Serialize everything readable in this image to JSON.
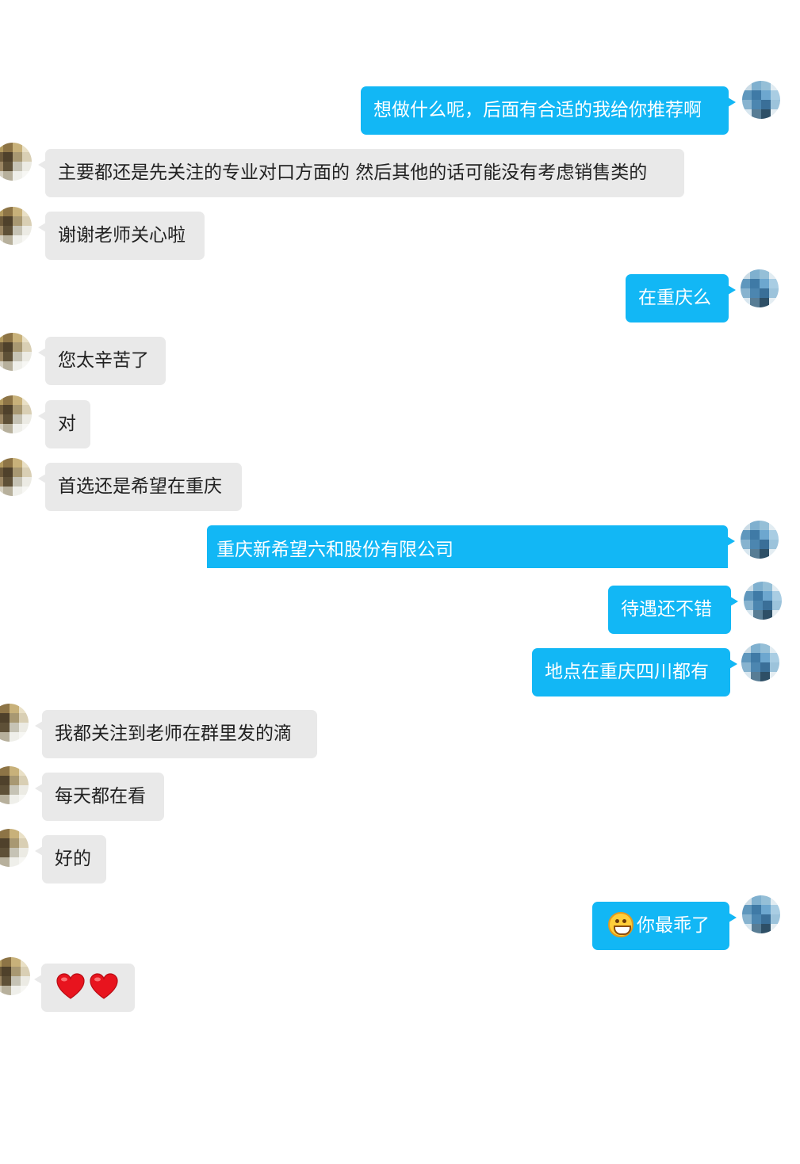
{
  "colors": {
    "incoming_bubble": "#e9e9e9",
    "outgoing_bubble": "#12b7f5",
    "incoming_text": "#222222",
    "outgoing_text": "#ffffff"
  },
  "messages": [
    {
      "side": "out",
      "text": "想做什么呢，后面有合适的我给你推荐啊"
    },
    {
      "side": "in",
      "text": "主要都还是先关注的专业对口方面的 然后其他的话可能没有考虑销售类的"
    },
    {
      "side": "in",
      "text": "谢谢老师关心啦"
    },
    {
      "side": "out",
      "text": "在重庆么"
    },
    {
      "side": "in",
      "text": "您太辛苦了"
    },
    {
      "side": "in",
      "text": "对"
    },
    {
      "side": "in",
      "text": "首选还是希望在重庆"
    },
    {
      "side": "out",
      "text": "重庆新希望六和股份有限公司"
    },
    {
      "side": "out",
      "text": "待遇还不错"
    },
    {
      "side": "out",
      "text": "地点在重庆四川都有"
    },
    {
      "side": "in",
      "text": "我都关注到老师在群里发的滴"
    },
    {
      "side": "in",
      "text": "每天都在看"
    },
    {
      "side": "in",
      "text": "好的"
    },
    {
      "side": "out",
      "text": "你最乖了",
      "emoji": "grinning-face-icon"
    },
    {
      "side": "in",
      "text": "",
      "emoji": "red-heart-icon x2"
    }
  ]
}
